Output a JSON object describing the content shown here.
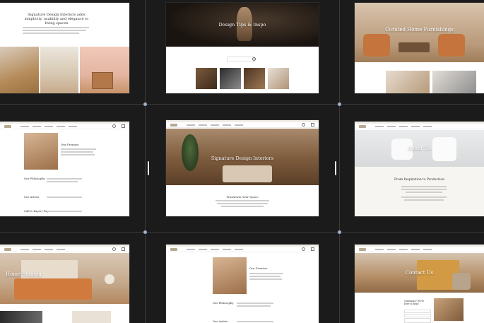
{
  "cards": {
    "signature_about": {
      "heading": "Signature Design Interiors adds simplicity, usability and elegance to living spaces"
    },
    "design_tips": {
      "hero_title": "Design Tips & Inspo"
    },
    "curated": {
      "hero_title": "Curated Home Furnishings"
    },
    "promise_page": {
      "section_title": "Our Promise",
      "philosophy": "Our Philosophy",
      "artists": "Our Artists",
      "cta": "Call & Export Pay"
    },
    "home_main": {
      "hero_title": "Signature Design Interiors",
      "section_title": "Transform Your Space"
    },
    "about_us": {
      "hero_title": "About Us",
      "section_title": "From Inspiration to Production"
    },
    "home_staging": {
      "hero_title": "Home Staging"
    },
    "promise_page_2": {
      "section_title": "Our Promise",
      "philosophy": "Our Philosophy",
      "artists": "Our Artists"
    },
    "contact": {
      "hero_title": "Contact Us",
      "form_title": "Questions? We're here to help!"
    }
  }
}
